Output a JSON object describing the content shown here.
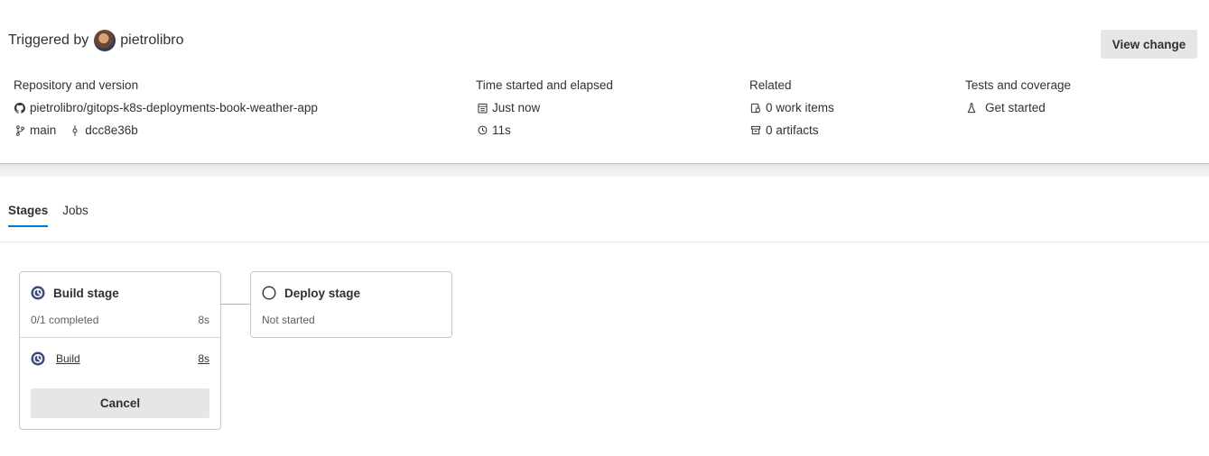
{
  "header": {
    "triggered_prefix": "Triggered by",
    "user": "pietrolibro",
    "view_change": "View change"
  },
  "summary": {
    "repository": {
      "title": "Repository and version",
      "repo": "pietrolibro/gitops-k8s-deployments-book-weather-app",
      "branch": "main",
      "commit": "dcc8e36b"
    },
    "time": {
      "title": "Time started and elapsed",
      "started": "Just now",
      "elapsed": "11s"
    },
    "related": {
      "title": "Related",
      "work_items": "0 work items",
      "artifacts": "0 artifacts"
    },
    "tests": {
      "title": "Tests and coverage",
      "action": "Get started"
    }
  },
  "tabs": [
    {
      "label": "Stages",
      "active": true
    },
    {
      "label": "Jobs",
      "active": false
    }
  ],
  "stages": {
    "build": {
      "name": "Build stage",
      "progress": "0/1 completed",
      "duration": "8s",
      "job_name": "Build",
      "job_duration": "8s",
      "cancel": "Cancel"
    },
    "deploy": {
      "name": "Deploy stage",
      "status": "Not started"
    }
  },
  "colors": {
    "accent": "#0078d4",
    "running_icon": "#3a4a7a",
    "button_bg": "#e6e6e6"
  }
}
